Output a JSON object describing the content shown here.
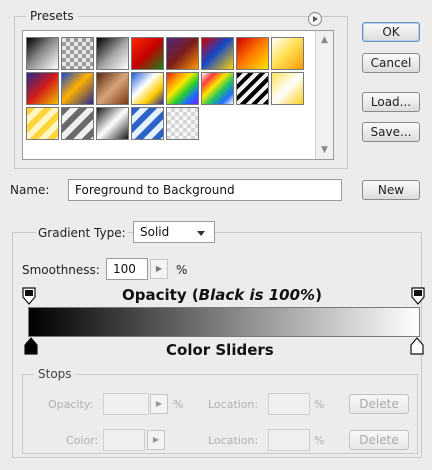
{
  "presets": {
    "title": "Presets",
    "menu_icon": "circle-arrow-icon",
    "swatches": [
      {
        "bg": "linear-gradient(135deg,#000 0%,#888 45%,#fff 100%)"
      },
      {
        "bg": "repeating-conic-gradient(#9a9a9a 0% 25%, #e7e7e7 0% 50%) 0 0/8px 8px"
      },
      {
        "bg": "linear-gradient(135deg,#000 0%,#aaa 55%,#fff 100%)"
      },
      {
        "bg": "linear-gradient(135deg,#ff2a00 0%,#c40000 50%,#1c7f19 100%)"
      },
      {
        "bg": "linear-gradient(135deg,#4c2a7c 0%,#7a1b1b 50%,#ff9900 100%)"
      },
      {
        "bg": "linear-gradient(135deg,#d40000 0%,#1447c8 45%,#ffd200 100%)"
      },
      {
        "bg": "linear-gradient(135deg,#d10000 0%,#ff7a00 50%,#ffe600 100%)"
      },
      {
        "bg": "linear-gradient(135deg,#ffffff 0%,#ffe35a 45%,#ff9c00 100%)"
      },
      {
        "bg": "linear-gradient(135deg,#2a2a8a 0%,#d11b1b 50%,#f4c000 100%)"
      },
      {
        "bg": "linear-gradient(135deg,#1847d4 0%,#ffb000 45%,#2a2a8a 100%)"
      },
      {
        "bg": "linear-gradient(135deg,#5a2a10 0%,#d8a27a 50%,#7a3a10 100%)"
      },
      {
        "bg": "linear-gradient(135deg,#1f5fd9 0%,#ffffff 40%,#ffcc00 70%,#2a2a8a 100%)"
      },
      {
        "bg": "linear-gradient(135deg,#e41b1b,#ff8a00,#ffe600,#2ad12a,#1a6cff,#7a1bff)"
      },
      {
        "bg": "linear-gradient(135deg,#ffffff 0%,#ff3b3b 20%,#ffe600 40%,#22c55e 60%,#1a6cff 80%,#ffffff 100%)"
      },
      {
        "bg": "repeating-linear-gradient(135deg,#000 0 4px,#f2f2f2 4px 8px)"
      },
      {
        "bg": "linear-gradient(135deg,#ffe45a 0%,#ffffff 50%,#ffcf1b 100%)"
      },
      {
        "bg": "repeating-linear-gradient(135deg,#ffd43b 0 6px,#fff6c2 6px 12px)"
      },
      {
        "bg": "repeating-linear-gradient(135deg,#6a6a6a 0 6px,#f0f0f0 6px 12px)"
      },
      {
        "bg": "linear-gradient(135deg,#1a1a1a 0%,#ffffff 50%,#1a1a1a 100%)"
      },
      {
        "bg": "repeating-linear-gradient(135deg,#2a62c8 0 6px,#e7f0ff 6px 12px)"
      },
      {
        "bg": "repeating-conic-gradient(#d6d6d6 0% 25%, #f6f6f6 0% 50%) 0 0/8px 8px"
      }
    ]
  },
  "buttons": {
    "ok": "OK",
    "cancel": "Cancel",
    "load": "Load...",
    "save": "Save...",
    "new": "New"
  },
  "name_field": {
    "label": "Name:",
    "value": "Foreground to Background"
  },
  "gradient": {
    "type_label": "Gradient Type:",
    "type_value": "Solid",
    "smoothness_label": "Smoothness:",
    "smoothness_value": "100",
    "smoothness_unit": "%",
    "opacity_title": "Opacity (Black is 100%)",
    "opacity_title_plain": "Opacity (",
    "opacity_title_italic": "Black is 100%",
    "opacity_title_close": ")",
    "color_sliders_title": "Color Sliders",
    "colors": {
      "start": "#000000",
      "end": "#ffffff"
    }
  },
  "stops": {
    "title": "Stops",
    "opacity_label": "Opacity:",
    "opacity_unit": "%",
    "location_label": "Location:",
    "location_unit": "%",
    "delete_label": "Delete",
    "color_label": "Color:",
    "location2_label": "Location:",
    "location2_unit": "%",
    "delete2_label": "Delete"
  }
}
